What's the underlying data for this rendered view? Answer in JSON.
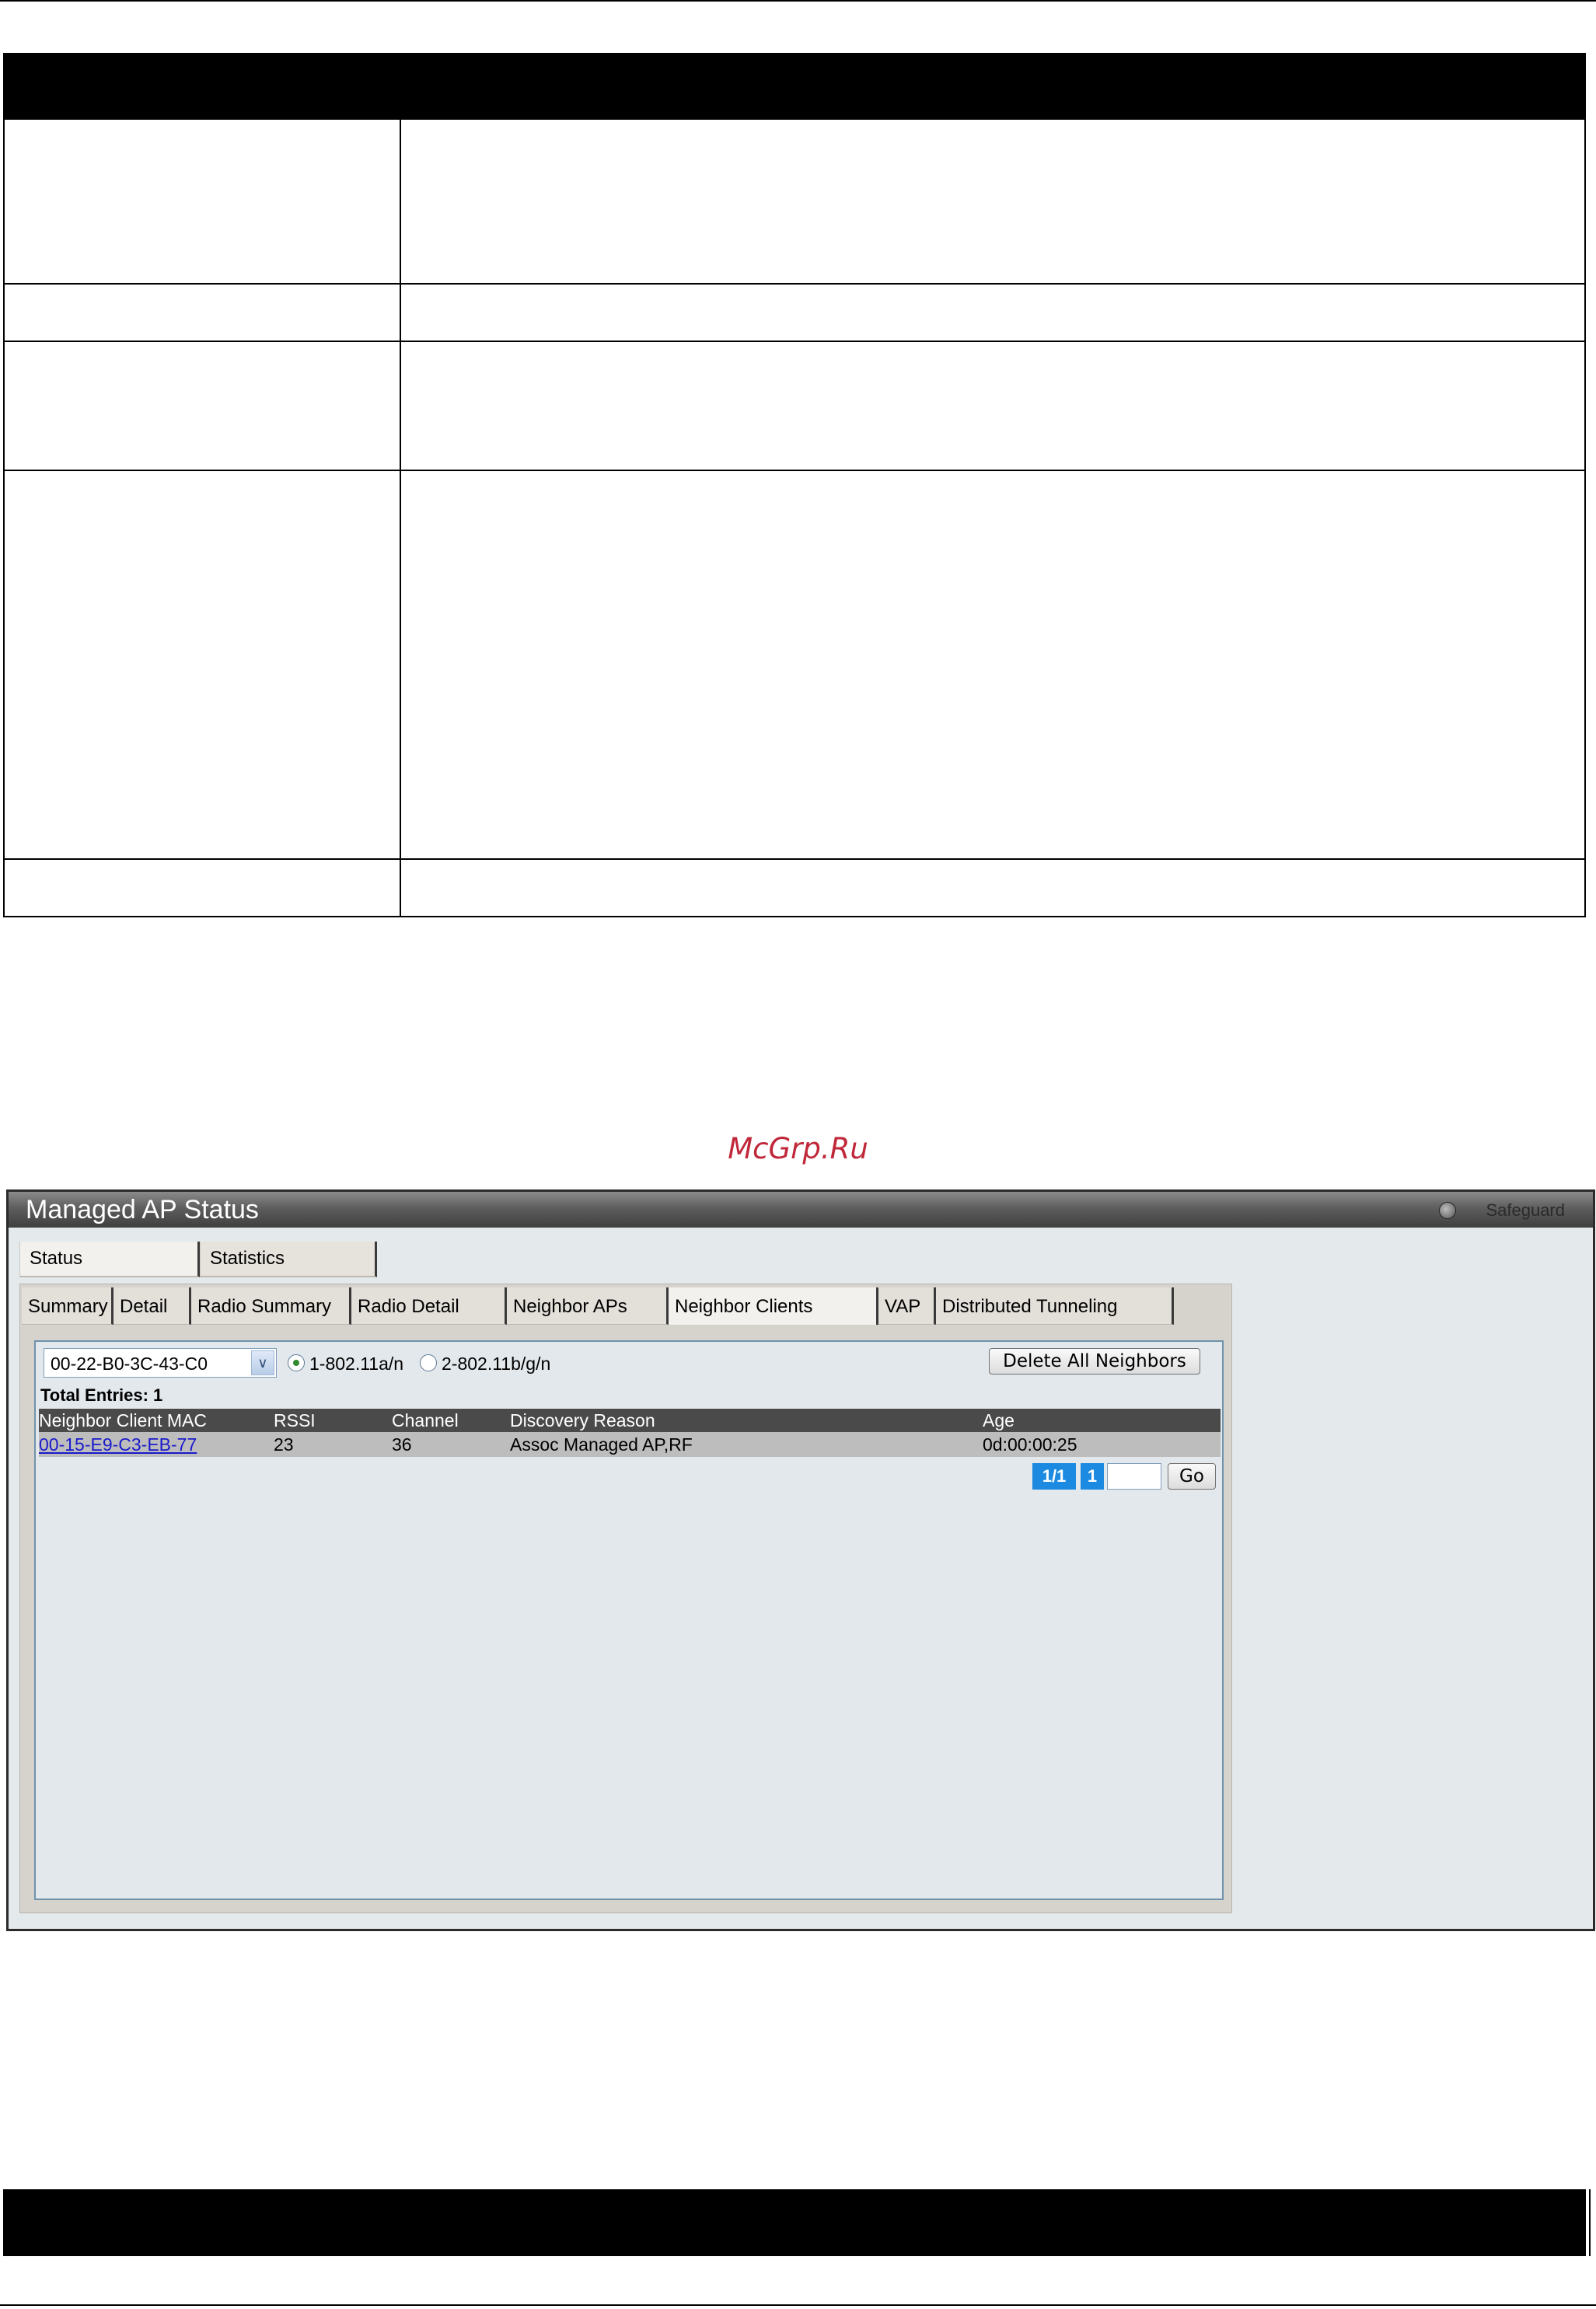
{
  "watermark": "McGrp.Ru",
  "window": {
    "title": "Managed AP Status",
    "safeguard": "Safeguard"
  },
  "top_tabs": [
    {
      "label": "Status"
    },
    {
      "label": "Statistics"
    }
  ],
  "sub_tabs": [
    {
      "label": "Summary"
    },
    {
      "label": "Detail"
    },
    {
      "label": "Radio Summary"
    },
    {
      "label": "Radio Detail"
    },
    {
      "label": "Neighbor APs"
    },
    {
      "label": "Neighbor Clients",
      "active": true
    },
    {
      "label": "VAP"
    },
    {
      "label": "Distributed Tunneling"
    }
  ],
  "controls": {
    "ap_select": "00-22-B0-3C-43-C0",
    "radio1_label": "1-802.11a/n",
    "radio2_label": "2-802.11b/g/n",
    "selected_radio": "1-802.11a/n",
    "delete_button": "Delete All Neighbors"
  },
  "table": {
    "total_label": "Total Entries: 1",
    "columns": [
      "Neighbor Client MAC",
      "RSSI",
      "Channel",
      "Discovery Reason",
      "Age"
    ],
    "rows": [
      {
        "mac": "00-15-E9-C3-EB-77",
        "rssi": "23",
        "channel": "36",
        "reason": "Assoc Managed AP,RF",
        "age": "0d:00:00:25"
      }
    ]
  },
  "pagination": {
    "current": "1/1",
    "page": "1",
    "go_label": "Go"
  }
}
